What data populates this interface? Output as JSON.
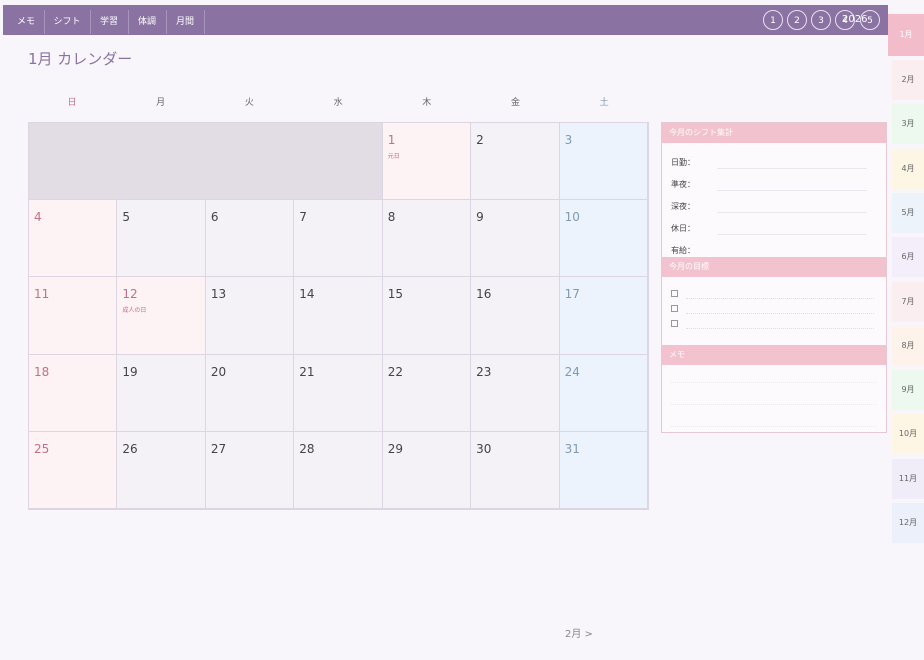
{
  "nav": {
    "tabs": [
      "メモ",
      "シフト",
      "学習",
      "体調",
      "月間"
    ],
    "week_buttons": [
      "1",
      "2",
      "3",
      "4",
      "5"
    ],
    "year": "2026"
  },
  "page_title": "1月 カレンダー",
  "weekdays": [
    "日",
    "月",
    "火",
    "水",
    "木",
    "金",
    "土"
  ],
  "calendar": {
    "leading_blank_days": 4,
    "days": [
      {
        "n": "1",
        "holiday": "元日"
      },
      {
        "n": "2"
      },
      {
        "n": "3"
      },
      {
        "n": "4"
      },
      {
        "n": "5"
      },
      {
        "n": "6"
      },
      {
        "n": "7"
      },
      {
        "n": "8"
      },
      {
        "n": "9"
      },
      {
        "n": "10"
      },
      {
        "n": "11"
      },
      {
        "n": "12",
        "holiday": "成人の日"
      },
      {
        "n": "13"
      },
      {
        "n": "14"
      },
      {
        "n": "15"
      },
      {
        "n": "16"
      },
      {
        "n": "17"
      },
      {
        "n": "18"
      },
      {
        "n": "19"
      },
      {
        "n": "20"
      },
      {
        "n": "21"
      },
      {
        "n": "22"
      },
      {
        "n": "23"
      },
      {
        "n": "24"
      },
      {
        "n": "25"
      },
      {
        "n": "26"
      },
      {
        "n": "27"
      },
      {
        "n": "28"
      },
      {
        "n": "29"
      },
      {
        "n": "30"
      },
      {
        "n": "31"
      }
    ]
  },
  "shift_summary": {
    "title": "今月のシフト集計",
    "rows": [
      "日勤：",
      "準夜：",
      "深夜：",
      "休日：",
      "有給："
    ]
  },
  "goals": {
    "title": "今月の目標",
    "checkbox": "☐",
    "count": 3
  },
  "memo": {
    "title": "メモ"
  },
  "month_tabs": [
    "1月",
    "2月",
    "3月",
    "4月",
    "5月",
    "6月",
    "7月",
    "8月",
    "9月",
    "10月",
    "11月",
    "12月"
  ],
  "month_tab_colors": [
    "#f2bccb",
    "#fbeef0",
    "#edf8ee",
    "#fdf6e4",
    "#ecf3fb",
    "#f3eef9",
    "#fbeef0",
    "#fdf3ea",
    "#edf8ee",
    "#fdf6e4",
    "#f0ecf8",
    "#ecf0fb"
  ],
  "next_month": "2月 >"
}
